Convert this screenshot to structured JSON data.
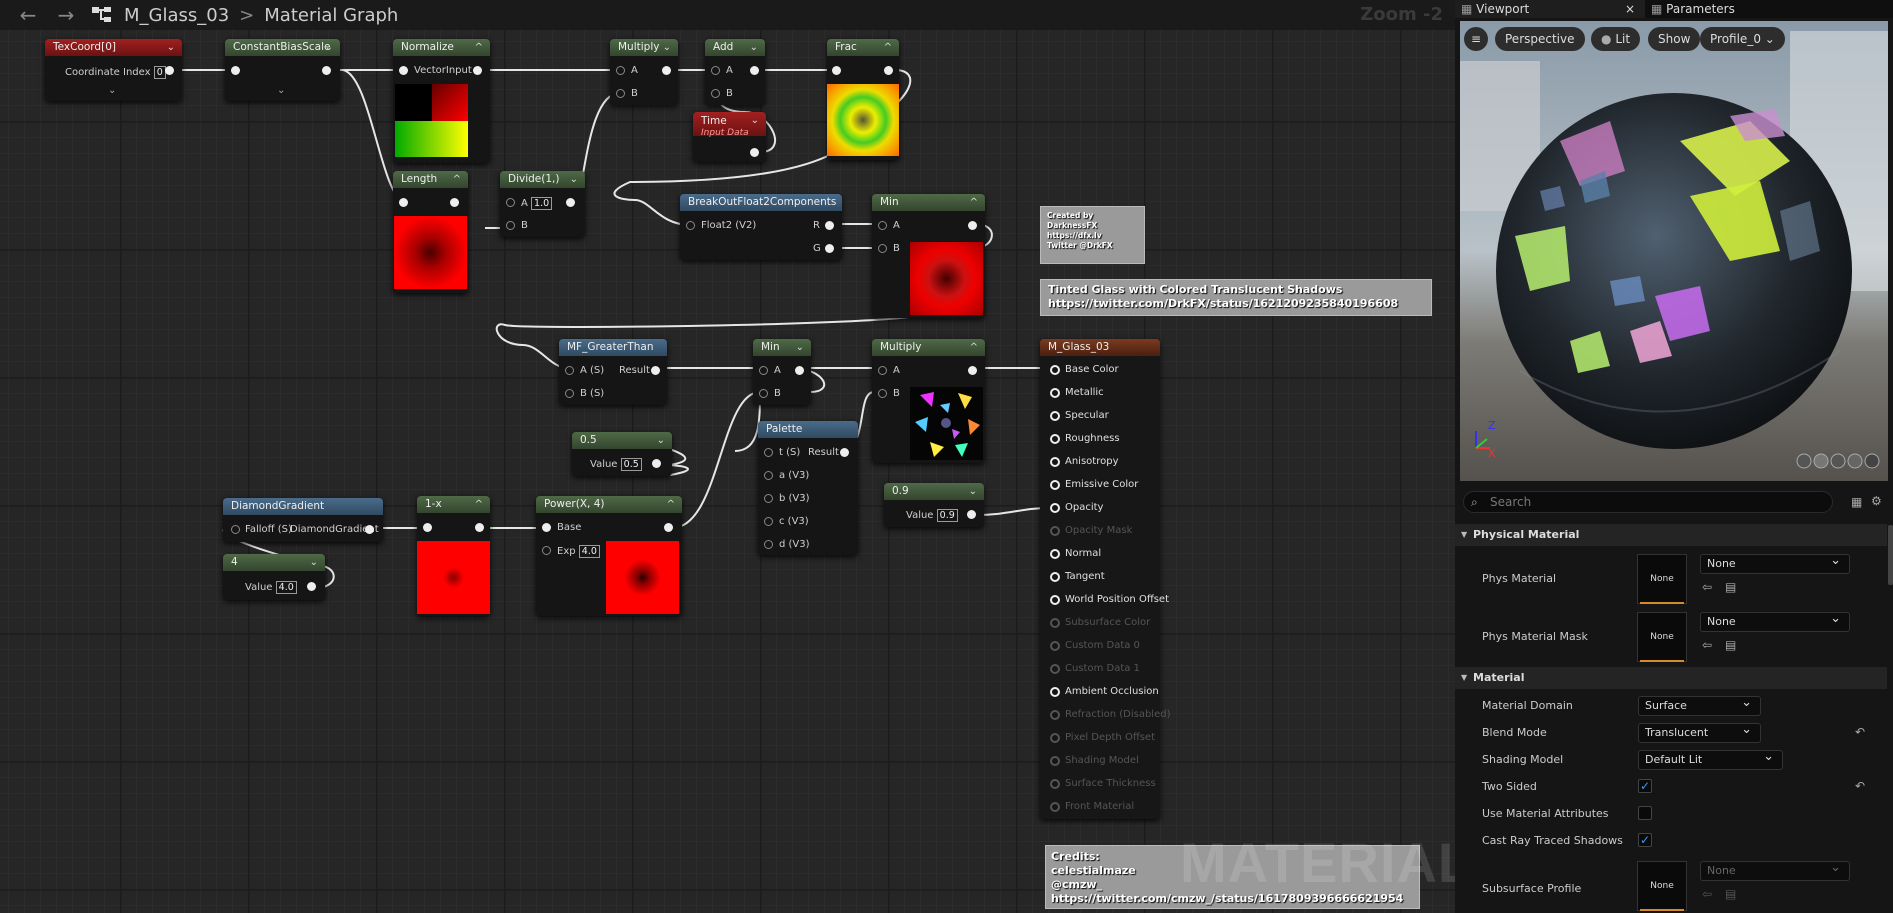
{
  "topbar": {
    "back_icon": "arrow-left-icon",
    "forward_icon": "arrow-right-icon",
    "asset": "M_Glass_03",
    "separator": ">",
    "graph": "Material Graph",
    "zoom": "Zoom -2"
  },
  "nodes": {
    "texcoord": {
      "title": "TexCoord[0]",
      "pin": "Coordinate Index",
      "value": "0"
    },
    "cbs": {
      "title": "ConstantBiasScale"
    },
    "normalize": {
      "title": "Normalize",
      "pin": "VectorInput"
    },
    "multiply1": {
      "title": "Multiply",
      "a": "A",
      "b": "B"
    },
    "add": {
      "title": "Add",
      "a": "A",
      "b": "B"
    },
    "frac": {
      "title": "Frac"
    },
    "time": {
      "title": "Time",
      "sub": "Input Data"
    },
    "length": {
      "title": "Length"
    },
    "divide": {
      "title": "Divide(1,)",
      "a": "A",
      "aval": "1.0",
      "b": "B"
    },
    "breakout": {
      "title": "BreakOutFloat2Components",
      "in": "Float2 (V2)",
      "r": "R",
      "g": "G"
    },
    "min1": {
      "title": "Min",
      "a": "A",
      "b": "B"
    },
    "mfgt": {
      "title": "MF_GreaterThan",
      "a": "A (S)",
      "b": "B (S)",
      "out": "Result"
    },
    "c05": {
      "title": "0.5",
      "label": "Value",
      "value": "0.5"
    },
    "min2": {
      "title": "Min",
      "a": "A",
      "b": "B"
    },
    "multiply2": {
      "title": "Multiply",
      "a": "A",
      "b": "B"
    },
    "palette": {
      "title": "Palette",
      "t": "t (S)",
      "a": "a (V3)",
      "b": "b (V3)",
      "c": "c (V3)",
      "d": "d (V3)",
      "out": "Result"
    },
    "c09": {
      "title": "0.9",
      "label": "Value",
      "value": "0.9"
    },
    "diamond": {
      "title": "DiamondGradient",
      "in": "Falloff (S)",
      "out": "DiamondGradient"
    },
    "c4": {
      "title": "4",
      "label": "Value",
      "value": "4.0"
    },
    "oneminus": {
      "title": "1-x"
    },
    "power": {
      "title": "Power(X, 4)",
      "base": "Base",
      "exp": "Exp",
      "expval": "4.0"
    },
    "result": {
      "title": "M_Glass_03",
      "pins": [
        {
          "label": "Base Color",
          "active": true
        },
        {
          "label": "Metallic",
          "active": true
        },
        {
          "label": "Specular",
          "active": true
        },
        {
          "label": "Roughness",
          "active": true
        },
        {
          "label": "Anisotropy",
          "active": true
        },
        {
          "label": "Emissive Color",
          "active": true
        },
        {
          "label": "Opacity",
          "active": true
        },
        {
          "label": "Opacity Mask",
          "active": false
        },
        {
          "label": "Normal",
          "active": true
        },
        {
          "label": "Tangent",
          "active": true
        },
        {
          "label": "World Position Offset",
          "active": true
        },
        {
          "label": "Subsurface Color",
          "active": false
        },
        {
          "label": "Custom Data 0",
          "active": false
        },
        {
          "label": "Custom Data 1",
          "active": false
        },
        {
          "label": "Ambient Occlusion",
          "active": true
        },
        {
          "label": "Refraction (Disabled)",
          "active": false
        },
        {
          "label": "Pixel Depth Offset",
          "active": false
        },
        {
          "label": "Shading Model",
          "active": false
        },
        {
          "label": "Surface Thickness",
          "active": false
        },
        {
          "label": "Front Material",
          "active": false
        }
      ]
    }
  },
  "comments": {
    "created": "Created by\nDarknessFX\nhttps://dfx.lv\nTwitter @DrkFX",
    "tinted": "Tinted Glass with Colored Translucent Shadows\nhttps://twitter.com/DrkFX/status/1621209235840196608",
    "credits": "Credits:\ncelestialmaze\n@cmzw_\nhttps://twitter.com/cmzw_/status/1617809396666621954"
  },
  "watermark": "MATERIAL",
  "panel": {
    "tab_viewport": "Viewport",
    "tab_close": "×",
    "tab_parameters": "Parameters",
    "viewport_buttons": {
      "menu": "≡",
      "perspective": "Perspective",
      "lit": "Lit",
      "show": "Show",
      "profile": "Profile_0"
    },
    "axis": {
      "z": "Z",
      "x": "X"
    },
    "search_placeholder": "Search",
    "sections": {
      "physical": {
        "title": "Physical Material",
        "rows": [
          {
            "label": "Phys Material",
            "thumb": "None",
            "value": "None"
          },
          {
            "label": "Phys Material Mask",
            "thumb": "None",
            "value": "None"
          }
        ]
      },
      "material": {
        "title": "Material",
        "rows": [
          {
            "label": "Material Domain",
            "value": "Surface"
          },
          {
            "label": "Blend Mode",
            "value": "Translucent"
          },
          {
            "label": "Shading Model",
            "value": "Default Lit"
          },
          {
            "label": "Two Sided",
            "checked": true
          },
          {
            "label": "Use Material Attributes",
            "checked": false
          },
          {
            "label": "Cast Ray Traced Shadows",
            "checked": true
          },
          {
            "label": "Subsurface Profile",
            "thumb": "None",
            "value": "None"
          }
        ]
      }
    }
  }
}
